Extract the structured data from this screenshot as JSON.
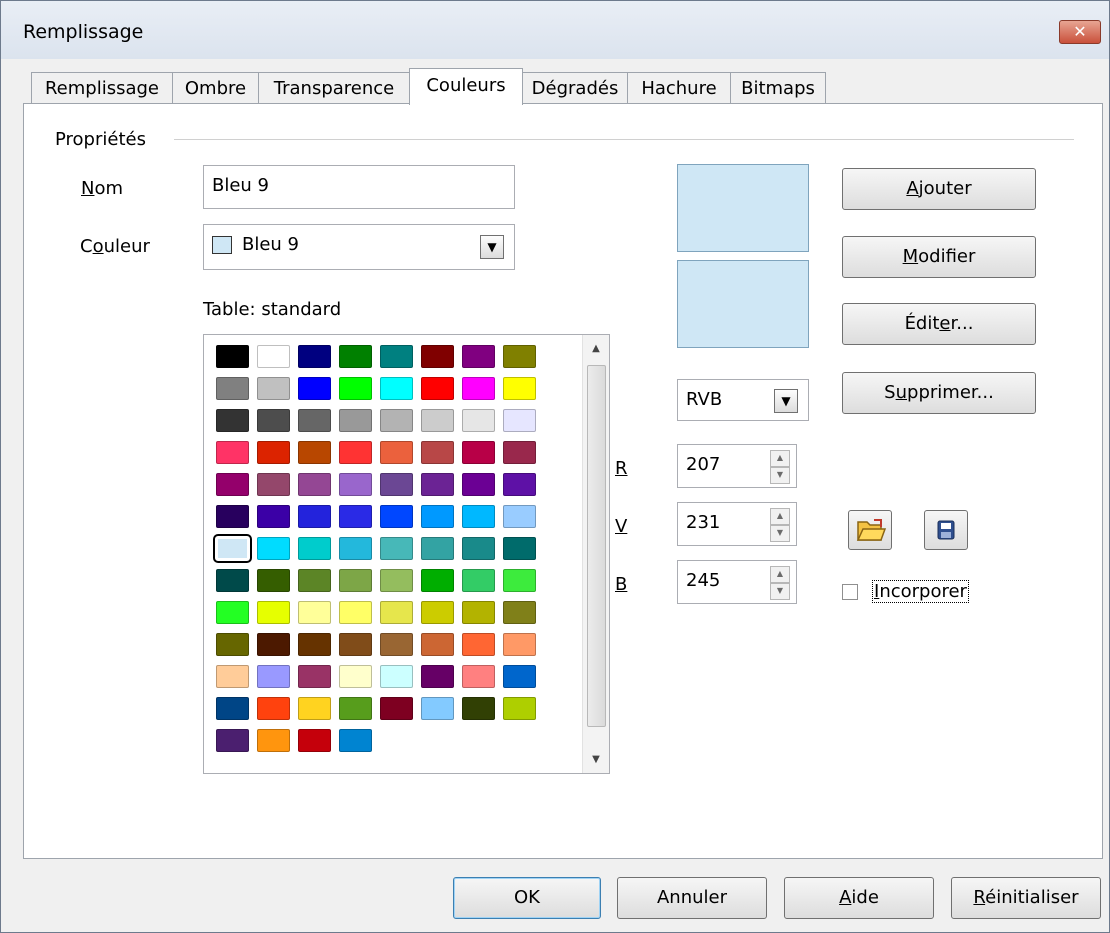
{
  "window": {
    "title": "Remplissage",
    "close_icon": "close-icon"
  },
  "tabs": [
    {
      "label": "Remplissage"
    },
    {
      "label": "Ombre"
    },
    {
      "label": "Transparence"
    },
    {
      "label": "Couleurs",
      "active": true
    },
    {
      "label": "Dégradés"
    },
    {
      "label": "Hachure"
    },
    {
      "label": "Bitmaps"
    }
  ],
  "properties": {
    "group_title": "Propriétés",
    "nom_label": "Nom",
    "nom_value": "Bleu 9",
    "couleur_label": "Couleur",
    "couleur_value": "Bleu 9",
    "table_label": "Table: standard"
  },
  "palette": [
    [
      "#000000",
      "#ffffff",
      "#000080",
      "#008000",
      "#008080",
      "#800000",
      "#800080",
      "#808000"
    ],
    [
      "#808080",
      "#c0c0c0",
      "#0000ff",
      "#00ff00",
      "#00ffff",
      "#ff0000",
      "#ff00ff",
      "#ffff00"
    ],
    [
      "#333333",
      "#4d4d4d",
      "#666666",
      "#999999",
      "#b3b3b3",
      "#cccccc",
      "#e6e6e6",
      "#e6e6ff"
    ],
    [
      "#ff3366",
      "#dc2300",
      "#b84700",
      "#ff3333",
      "#eb613d",
      "#b84747",
      "#b80047",
      "#99284c"
    ],
    [
      "#94006b",
      "#94476b",
      "#944794",
      "#9966cc",
      "#6b4794",
      "#6b2394",
      "#6b0094",
      "#5e11a6"
    ],
    [
      "#28005e",
      "#3b00a6",
      "#2323dc",
      "#2a2ae6",
      "#0047ff",
      "#0099ff",
      "#00b8ff",
      "#99ccff"
    ],
    [
      "#cfe7f5",
      "#00dcff",
      "#00cccc",
      "#23b8dc",
      "#47b8b8",
      "#33a3a3",
      "#198a8a",
      "#006b6b"
    ],
    [
      "#004a4a",
      "#355e00",
      "#5c8526",
      "#7da647",
      "#94bd5e",
      "#00ae00",
      "#33cc66",
      "#3deb3d"
    ],
    [
      "#23ff23",
      "#e6ff00",
      "#ffff99",
      "#ffff66",
      "#e6e64c",
      "#cccc00",
      "#b3b300",
      "#808019"
    ],
    [
      "#666600",
      "#4c1900",
      "#663300",
      "#804c19",
      "#996633",
      "#cc6633",
      "#ff6633",
      "#ff9966"
    ],
    [
      "#ffcc99",
      "#9999ff",
      "#993366",
      "#ffffcc",
      "#ccffff",
      "#660066",
      "#ff8080",
      "#0066cc"
    ],
    [
      "#004586",
      "#ff420e",
      "#ffd320",
      "#579d1c",
      "#7e0021",
      "#83caff",
      "#314004",
      "#aecf00"
    ],
    [
      "#4b1f6f",
      "#ff950e",
      "#c5000b",
      "#0084d1"
    ]
  ],
  "preview": {
    "color": "#cfe7f5"
  },
  "mode": {
    "value": "RVB"
  },
  "rgb": {
    "r_label": "R",
    "r_value": "207",
    "v_label": "V",
    "v_value": "231",
    "b_label": "B",
    "b_value": "245"
  },
  "buttons": {
    "ajouter": "Ajouter",
    "modifier": "Modifier",
    "editer": "Éditer...",
    "supprimer": "Supprimer..."
  },
  "incorporer_label": "Incorporer",
  "footer": {
    "ok": "OK",
    "annuler": "Annuler",
    "aide": "Aide",
    "reinitialiser": "Réinitialiser"
  }
}
